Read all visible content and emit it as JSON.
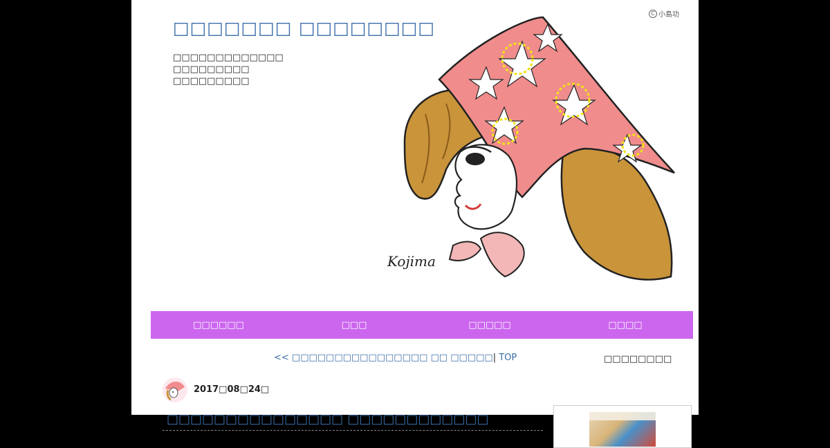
{
  "header": {
    "site_title": "□□□□□□□ □□□□□□□□",
    "description_lines": [
      "□□□□□□□□□□□□□",
      "□□□□□□□□□",
      "□□□□□□□□□"
    ],
    "copyright_symbol": "C",
    "copyright_text": "小島功"
  },
  "nav": {
    "items": [
      {
        "label": "□□□□□□"
      },
      {
        "label": "□□□"
      },
      {
        "label": "□□□□□"
      },
      {
        "label": "□□□□"
      }
    ],
    "bg_color": "#cc66ee"
  },
  "post_navigation": {
    "prev_link": "<< □□□□□□□□□□□□□□□□ □□ □□□□□",
    "separator": "|",
    "top_link": "TOP"
  },
  "sidebar": {
    "title": "□□□□□□□□"
  },
  "post": {
    "date": "2017□08□24□",
    "title": "□□□□□□□□□□□□□□□ □□□□□□□□□□□□"
  },
  "icons": {
    "illustration": "woman-with-sakura-headscarf-illustration",
    "avatar": "author-avatar-icon",
    "copyright": "copyright-icon"
  },
  "colors": {
    "title": "#3b6ea8",
    "link": "#3b6ea8",
    "nav_bg": "#cc66ee",
    "scarf_pink": "#f08c8c",
    "hair_gold": "#c9943a"
  }
}
